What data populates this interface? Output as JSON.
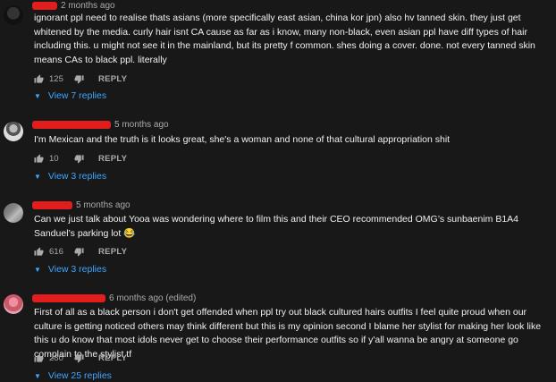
{
  "comments": [
    {
      "time": "2 months ago",
      "text": "ignorant ppl need to realise thats asians (more specifically east asian, china kor jpn) also hv tanned skin. they just get whitened by the media. curly hair isnt CA cause as far as i know, many non-black, even asian ppl have diff types of hair including this. u might not see it in the mainland, but its pretty f common. shes doing a cover. done. not every tanned skin means CAs to black ppl. literally",
      "likes": "125",
      "reply": "REPLY",
      "view_replies": "View 7 replies"
    },
    {
      "time": "5 months ago",
      "text": "I'm Mexican and the truth is it looks great, she's a woman and none of that cultural appropriation shit",
      "likes": "10",
      "reply": "REPLY",
      "view_replies": "View 3 replies"
    },
    {
      "time": "5 months ago",
      "text": "Can we just talk about Yooa was wondering where to film this and their CEO recommended OMG’s sunbaenim B1A4 Sanduel’s parking lot 😂",
      "likes": "616",
      "reply": "REPLY",
      "view_replies": "View 3 replies"
    },
    {
      "time": "6 months ago (edited)",
      "text": "First of all as a black person i don't get offended when ppl try out black cultured hairs outfits I feel quite proud when our culture is getting noticed others may think different but this is my opinion second I blame her stylist for making her look like this u do know that most idols never get to choose their performance outfits so if y'all wanna be angry at someone go complain to the stylist tf",
      "likes": "280",
      "reply": "REPLY",
      "view_replies": "View 25 replies"
    }
  ],
  "colors": {
    "background": "#181818",
    "text": "#f1f1f1",
    "muted": "#aaaaaa",
    "link": "#3ea6ff",
    "redaction": "#e01e1e"
  },
  "icons": {
    "like": "thumbs-up-icon",
    "dislike": "thumbs-down-icon",
    "expand": "caret-down-icon"
  }
}
